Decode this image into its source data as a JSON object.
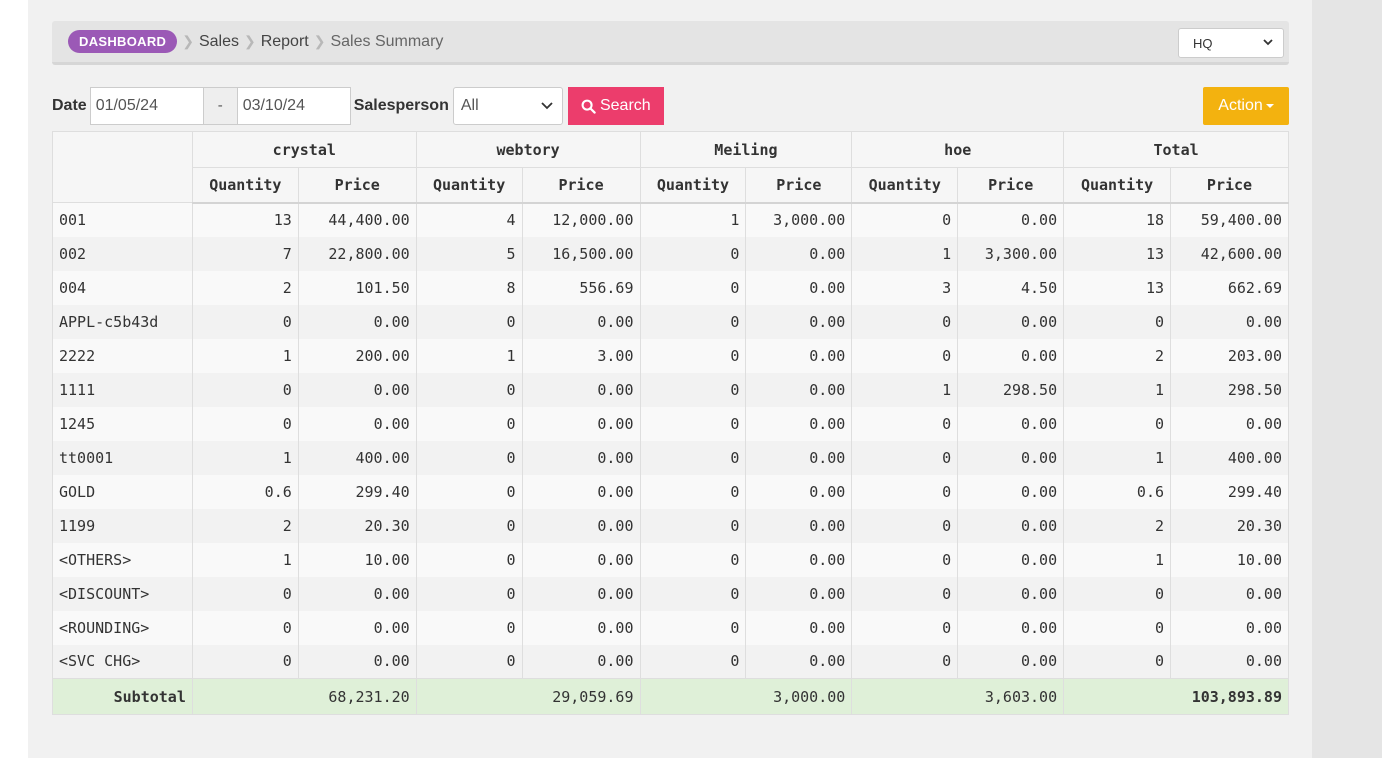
{
  "breadcrumb": {
    "dashboard": "DASHBOARD",
    "items": [
      "Sales",
      "Report",
      "Sales Summary"
    ]
  },
  "branch_select": {
    "value": "HQ"
  },
  "filters": {
    "date_label": "Date",
    "date_from": "01/05/24",
    "date_separator": "-",
    "date_to": "03/10/24",
    "salesperson_label": "Salesperson",
    "salesperson_value": "All",
    "search_label": "Search"
  },
  "action_label": "Action",
  "table": {
    "groups": [
      "crystal",
      "webtory",
      "Meiling",
      "hoe",
      "Total"
    ],
    "subheaders": {
      "quantity": "Quantity",
      "price": "Price"
    },
    "rows": [
      [
        "001",
        "13",
        "44,400.00",
        "4",
        "12,000.00",
        "1",
        "3,000.00",
        "0",
        "0.00",
        "18",
        "59,400.00"
      ],
      [
        "002",
        "7",
        "22,800.00",
        "5",
        "16,500.00",
        "0",
        "0.00",
        "1",
        "3,300.00",
        "13",
        "42,600.00"
      ],
      [
        "004",
        "2",
        "101.50",
        "8",
        "556.69",
        "0",
        "0.00",
        "3",
        "4.50",
        "13",
        "662.69"
      ],
      [
        "APPL-c5b43d",
        "0",
        "0.00",
        "0",
        "0.00",
        "0",
        "0.00",
        "0",
        "0.00",
        "0",
        "0.00"
      ],
      [
        "2222",
        "1",
        "200.00",
        "1",
        "3.00",
        "0",
        "0.00",
        "0",
        "0.00",
        "2",
        "203.00"
      ],
      [
        "1111",
        "0",
        "0.00",
        "0",
        "0.00",
        "0",
        "0.00",
        "1",
        "298.50",
        "1",
        "298.50"
      ],
      [
        "1245",
        "0",
        "0.00",
        "0",
        "0.00",
        "0",
        "0.00",
        "0",
        "0.00",
        "0",
        "0.00"
      ],
      [
        "tt0001",
        "1",
        "400.00",
        "0",
        "0.00",
        "0",
        "0.00",
        "0",
        "0.00",
        "1",
        "400.00"
      ],
      [
        "GOLD",
        "0.6",
        "299.40",
        "0",
        "0.00",
        "0",
        "0.00",
        "0",
        "0.00",
        "0.6",
        "299.40"
      ],
      [
        "1199",
        "2",
        "20.30",
        "0",
        "0.00",
        "0",
        "0.00",
        "0",
        "0.00",
        "2",
        "20.30"
      ],
      [
        "<OTHERS>",
        "1",
        "10.00",
        "0",
        "0.00",
        "0",
        "0.00",
        "0",
        "0.00",
        "1",
        "10.00"
      ],
      [
        "<DISCOUNT>",
        "0",
        "0.00",
        "0",
        "0.00",
        "0",
        "0.00",
        "0",
        "0.00",
        "0",
        "0.00"
      ],
      [
        "<ROUNDING>",
        "0",
        "0.00",
        "0",
        "0.00",
        "0",
        "0.00",
        "0",
        "0.00",
        "0",
        "0.00"
      ],
      [
        "<SVC CHG>",
        "0",
        "0.00",
        "0",
        "0.00",
        "0",
        "0.00",
        "0",
        "0.00",
        "0",
        "0.00"
      ]
    ],
    "subtotal_label": "Subtotal",
    "subtotals": [
      "68,231.20",
      "29,059.69",
      "3,000.00",
      "3,603.00",
      "103,893.89"
    ]
  },
  "colors": {
    "dashboard_badge": "#9b59b6",
    "search_button": "#ec3d6c",
    "action_button": "#f3b20f",
    "subtotal_row": "#dff0d8"
  },
  "icons": [
    "chevron-right-icon",
    "chevron-down-icon",
    "search-icon",
    "caret-down-icon"
  ]
}
